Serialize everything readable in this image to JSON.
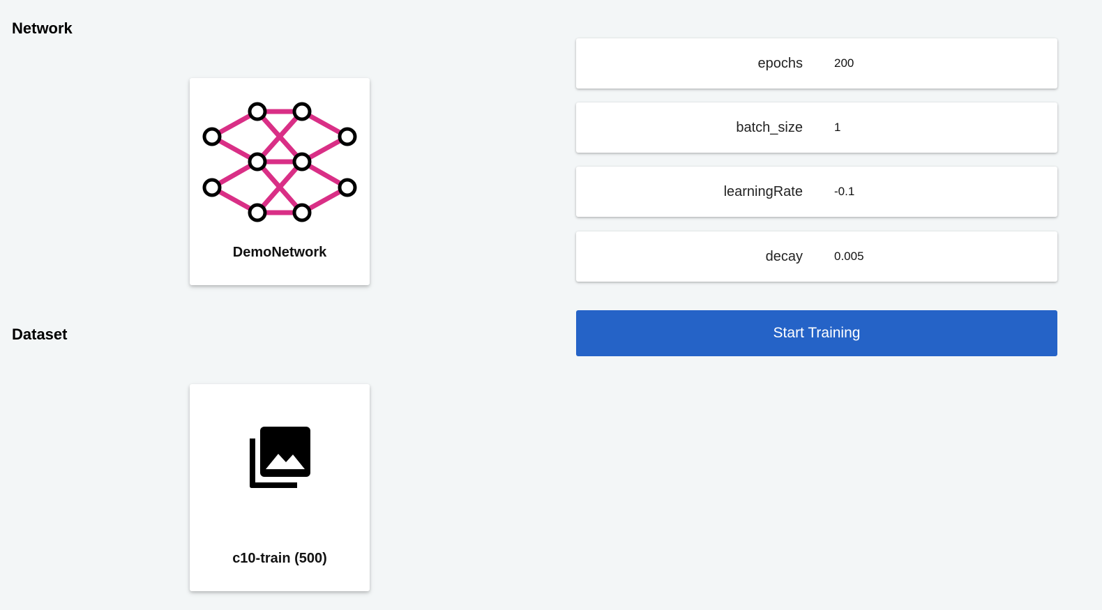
{
  "network": {
    "section_title": "Network",
    "card_label": "DemoNetwork",
    "icon": "neural-network-icon",
    "icon_colors": {
      "edges": "#d92f86",
      "nodes": "#000000"
    }
  },
  "dataset": {
    "section_title": "Dataset",
    "card_label": "c10-train (500)",
    "icon": "image-collection-icon"
  },
  "params": {
    "epochs": {
      "label": "epochs",
      "value": "200"
    },
    "batch_size": {
      "label": "batch_size",
      "value": "1"
    },
    "learningRate": {
      "label": "learningRate",
      "value": "-0.1"
    },
    "decay": {
      "label": "decay",
      "value": "0.005"
    }
  },
  "actions": {
    "start_label": "Start Training",
    "start_color": "#2563c7"
  },
  "theme": {
    "background": "#f3f6f7",
    "card_background": "#ffffff"
  }
}
